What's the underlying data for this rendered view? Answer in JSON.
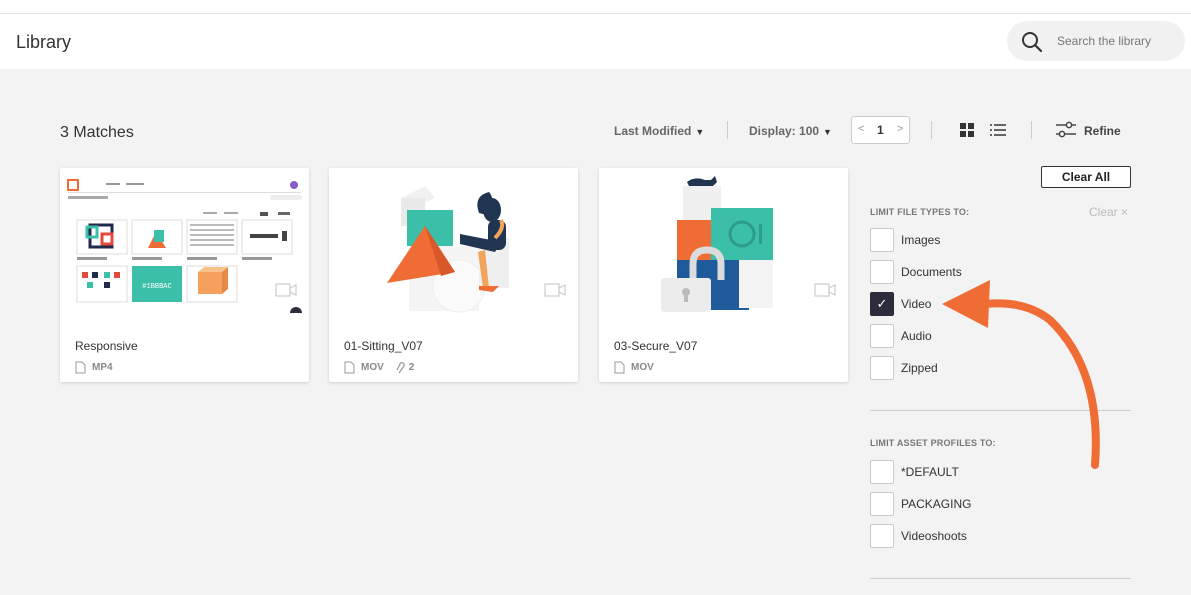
{
  "header": {
    "title": "Library",
    "search_placeholder": "Search the library"
  },
  "toolbar": {
    "matches": "3 Matches",
    "sort_label": "Last Modified",
    "display_label": "Display: 100",
    "page_number": "1",
    "refine_label": "Refine"
  },
  "cards": [
    {
      "name": "Responsive",
      "type": "MP4"
    },
    {
      "name": "01-Sitting_V07",
      "type": "MOV",
      "attachments": "2"
    },
    {
      "name": "03-Secure_V07",
      "type": "MOV"
    }
  ],
  "sidebar": {
    "clear_all": "Clear All",
    "file_types_heading": "LIMIT FILE TYPES TO:",
    "clear_link": "Clear",
    "file_types": [
      {
        "label": "Images",
        "checked": false
      },
      {
        "label": "Documents",
        "checked": false
      },
      {
        "label": "Video",
        "checked": true
      },
      {
        "label": "Audio",
        "checked": false
      },
      {
        "label": "Zipped",
        "checked": false
      }
    ],
    "asset_profiles_heading": "LIMIT ASSET PROFILES TO:",
    "asset_profiles": [
      {
        "label": "*DEFAULT",
        "checked": false
      },
      {
        "label": "PACKAGING",
        "checked": false
      },
      {
        "label": "Videoshoots",
        "checked": false
      }
    ]
  },
  "thumbnail_mini": {
    "swatch_text": "#1BBBAC"
  },
  "colors": {
    "accent_orange": "#ef6c35",
    "teal": "#3bbfa8",
    "navy": "#2c2c3a"
  }
}
